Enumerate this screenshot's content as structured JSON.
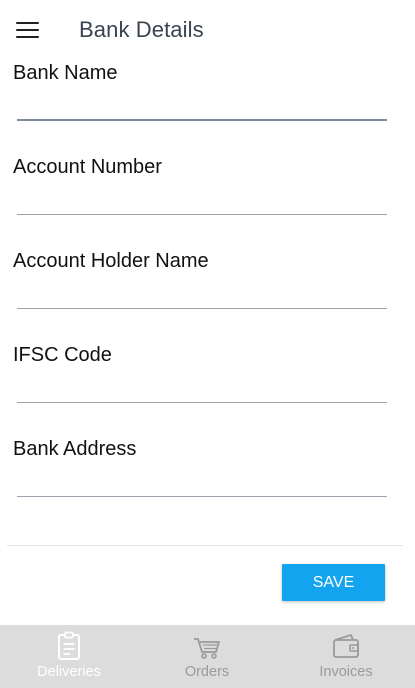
{
  "header": {
    "title": "Bank Details"
  },
  "form": {
    "fields": [
      {
        "label": "Bank Name",
        "value": ""
      },
      {
        "label": "Account Number",
        "value": ""
      },
      {
        "label": "Account Holder Name",
        "value": ""
      },
      {
        "label": "IFSC Code",
        "value": ""
      },
      {
        "label": "Bank Address",
        "value": ""
      }
    ],
    "save_label": "SAVE"
  },
  "bottom_nav": {
    "items": [
      {
        "label": "Deliveries",
        "icon": "clipboard-icon",
        "active": true
      },
      {
        "label": "Orders",
        "icon": "cart-icon",
        "active": false
      },
      {
        "label": "Invoices",
        "icon": "wallet-icon",
        "active": false
      }
    ]
  },
  "colors": {
    "accent": "#12a4ef",
    "nav_background": "#dcdcdc",
    "nav_inactive": "#9a9a9a",
    "nav_active": "#ffffff"
  }
}
